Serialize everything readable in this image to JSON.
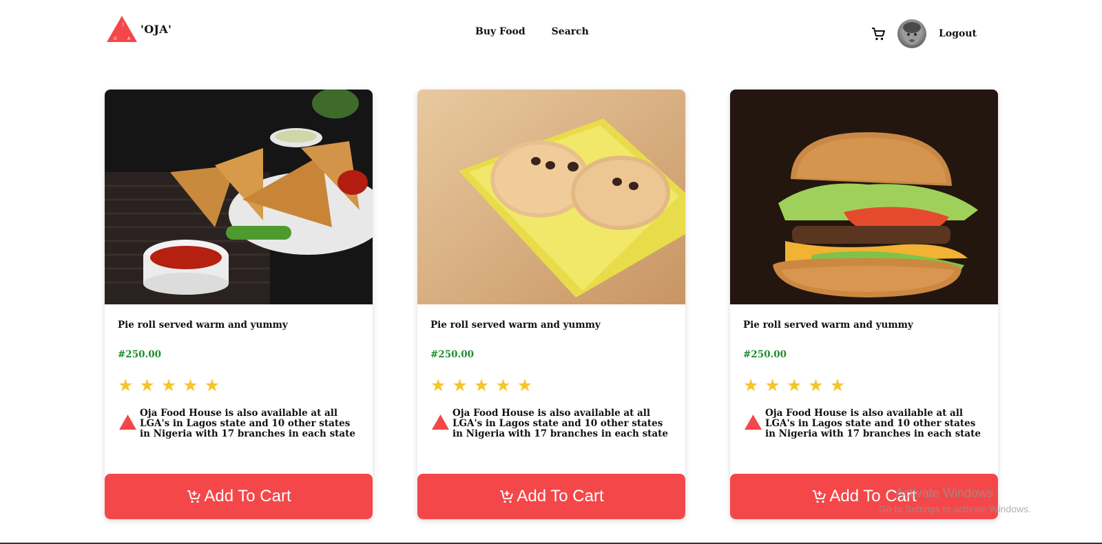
{
  "nav": {
    "brand": "'OJA'",
    "logo_letters": [
      "J",
      "O",
      "A"
    ],
    "links": [
      "Buy Food",
      "Search"
    ],
    "logout": "Logout",
    "icons": {
      "cart": "cart-icon",
      "avatar": "user-avatar"
    }
  },
  "products": [
    {
      "image": "samosa-with-sauce-photo",
      "title": "Pie roll served warm and yummy",
      "price": "#250.00",
      "rating": 5,
      "info": "Oja Food House is also available at all LGA's in Lagos state and 10 other states in Nigeria with 17 branches in each state",
      "button": "Add To Cart"
    },
    {
      "image": "cookies-on-yellow-plate-photo",
      "title": "Pie roll served warm and yummy",
      "price": "#250.00",
      "rating": 5,
      "info": "Oja Food House is also available at all LGA's in Lagos state and 10 other states in Nigeria with 17 branches in each state",
      "button": "Add To Cart"
    },
    {
      "image": "burger-photo",
      "title": "Pie roll served warm and yummy",
      "price": "#250.00",
      "rating": 5,
      "info": "Oja Food House is also available at all LGA's in Lagos state and 10 other states in Nigeria with 17 branches in each state",
      "button": "Add To Cart"
    }
  ],
  "watermark": {
    "title": "Activate Windows",
    "subtitle": "Go to Settings to activate Windows."
  },
  "colors": {
    "accent": "#f4474a",
    "price": "#1e8e2c",
    "star": "#f5c52b"
  }
}
